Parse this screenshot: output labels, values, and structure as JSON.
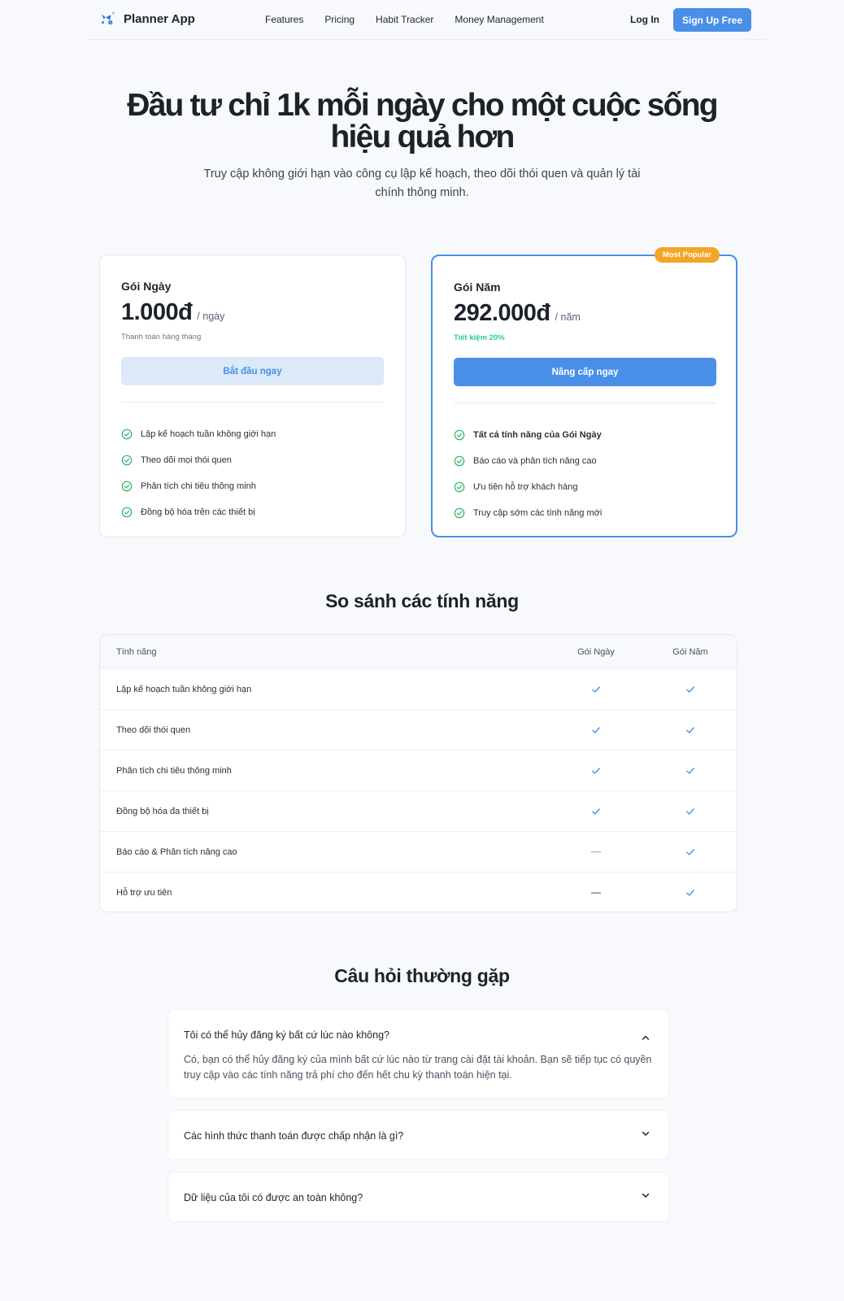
{
  "app": {
    "name": "Planner App"
  },
  "nav": {
    "links": [
      "Features",
      "Pricing",
      "Habit Tracker",
      "Money Management"
    ],
    "login": "Log In",
    "signup": "Sign Up Free"
  },
  "hero": {
    "title": "Đầu tư chỉ 1k mỗi ngày cho một cuộc sống hiệu quả hơn",
    "subtitle": "Truy cập không giới hạn vào công cụ lập kế hoạch, theo dõi thói quen và quản lý tài chính thông minh."
  },
  "plans": {
    "day": {
      "name": "Gói Ngày",
      "price": "1.000đ",
      "period": "/ ngày",
      "note": "Thanh toán hàng tháng",
      "button": "Bắt đầu ngay",
      "features": [
        "Lập kế hoạch tuần không giới hạn",
        "Theo dõi mọi thói quen",
        "Phân tích chi tiêu thông minh",
        "Đồng bộ hóa trên các thiết bị"
      ]
    },
    "year": {
      "badge": "Most Popular",
      "name": "Gói Năm",
      "price": "292.000đ",
      "period": "/ năm",
      "note": "Tiết kiệm 20%",
      "button": "Nâng cấp ngay",
      "features": [
        "Tất cả tính năng của Gói Ngày",
        "Báo cáo và phân tích nâng cao",
        "Ưu tiên hỗ trợ khách hàng",
        "Truy cập sớm các tính năng mới"
      ]
    }
  },
  "compare": {
    "title": "So sánh các tính năng",
    "headers": [
      "Tính năng",
      "Gói Ngày",
      "Gói Năm"
    ],
    "rows": [
      {
        "feature": "Lập kế hoạch tuần không giới hạn",
        "day": true,
        "year": true
      },
      {
        "feature": "Theo dõi thói quen",
        "day": true,
        "year": true
      },
      {
        "feature": "Phân tích chi tiêu thông minh",
        "day": true,
        "year": true
      },
      {
        "feature": "Đồng bộ hóa đa thiết bị",
        "day": true,
        "year": true
      },
      {
        "feature": "Báo cáo & Phân tích nâng cao",
        "day": false,
        "year": true
      },
      {
        "feature": "Hỗ trợ ưu tiên",
        "day": false,
        "year": true
      }
    ]
  },
  "faq": {
    "title": "Câu hỏi thường gặp",
    "items": [
      {
        "q": "Tôi có thể hủy đăng ký bất cứ lúc nào không?",
        "a": "Có, bạn có thể hủy đăng ký của mình bất cứ lúc nào từ trang cài đặt tài khoản. Bạn sẽ tiếp tục có quyền truy cập vào các tính năng trả phí cho đến hết chu kỳ thanh toán hiện tại.",
        "open": true
      },
      {
        "q": "Các hình thức thanh toán được chấp nhận là gì?",
        "a": "",
        "open": false
      },
      {
        "q": "Dữ liệu của tôi có được an toàn không?",
        "a": "",
        "open": false
      }
    ]
  },
  "colors": {
    "accent": "#4a8fe7",
    "badge": "#f2a627",
    "check": "#2fb36a",
    "save": "#2cc8a2"
  }
}
